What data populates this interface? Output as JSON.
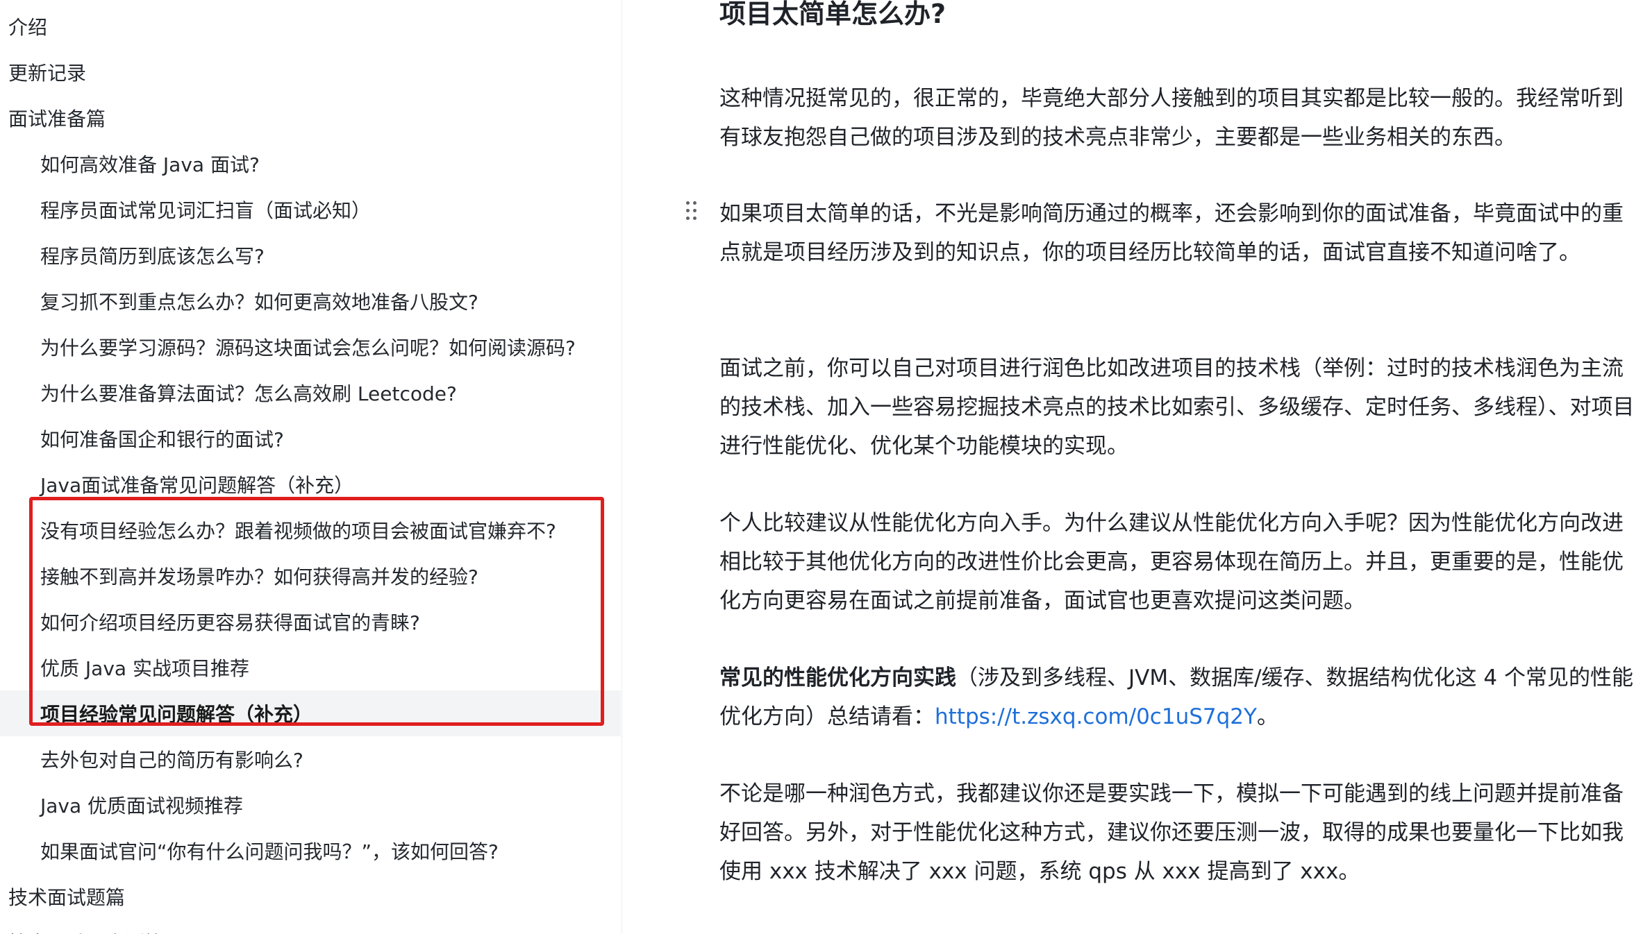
{
  "sidebar": {
    "items": [
      {
        "label": "介绍"
      },
      {
        "label": "更新记录"
      },
      {
        "label": "面试准备篇"
      },
      {
        "label": "如何高效准备 Java 面试?"
      },
      {
        "label": "程序员面试常见词汇扫盲（面试必知）"
      },
      {
        "label": "程序员简历到底该怎么写?"
      },
      {
        "label": "复习抓不到重点怎么办？如何更高效地准备八股文?"
      },
      {
        "label": "为什么要学习源码？源码这块面试会怎么问呢？如何阅读源码?"
      },
      {
        "label": "为什么要准备算法面试？怎么高效刷 Leetcode?"
      },
      {
        "label": "如何准备国企和银行的面试?"
      },
      {
        "label": "Java面试准备常见问题解答（补充）"
      },
      {
        "label": "没有项目经验怎么办？跟着视频做的项目会被面试官嫌弃不?"
      },
      {
        "label": "接触不到高并发场景咋办？如何获得高并发的经验?"
      },
      {
        "label": "如何介绍项目经历更容易获得面试官的青睐?"
      },
      {
        "label": "优质 Java 实战项目推荐"
      },
      {
        "label": "项目经验常见问题解答（补充）"
      },
      {
        "label": "去外包对自己的简历有影响么?"
      },
      {
        "label": "Java 优质面试视频推荐"
      },
      {
        "label": "如果面试官问“你有什么问题问我吗？”，该如何回答?"
      },
      {
        "label": "技术面试题篇"
      },
      {
        "label": "技术面试题自测篇"
      }
    ]
  },
  "content": {
    "heading": "项目太简单怎么办?",
    "p1": "这种情况挺常见的，很正常的，毕竟绝大部分人接触到的项目其实都是比较一般的。我经常听到有球友抱怨自己做的项目涉及到的技术亮点非常少，主要都是一些业务相关的东西。",
    "p2": "如果项目太简单的话，不光是影响简历通过的概率，还会影响到你的面试准备，毕竟面试中的重点就是项目经历涉及到的知识点，你的项目经历比较简单的话，面试官直接不知道问啥了。",
    "p3": "面试之前，你可以自己对项目进行润色比如改进项目的技术栈（举例：过时的技术栈润色为主流的技术栈、加入一些容易挖掘技术亮点的技术比如索引、多级缓存、定时任务、多线程）、对项目进行性能优化、优化某个功能模块的实现。",
    "p4": "个人比较建议从性能优化方向入手。为什么建议从性能优化方向入手呢？因为性能优化方向改进相比较于其他优化方向的改进性价比会更高，更容易体现在简历上。并且，更重要的是，性能优化方向更容易在面试之前提前准备，面试官也更喜欢提问这类问题。",
    "p5_bold": "常见的性能优化方向实践",
    "p5_text": "（涉及到多线程、JVM、数据库/缓存、数据结构优化这 4 个常见的性能优化方向）总结请看：",
    "p5_link": "https://t.zsxq.com/0c1uS7q2Y",
    "p5_end": "。",
    "p6": "不论是哪一种润色方式，我都建议你还是要实践一下，模拟一下可能遇到的线上问题并提前准备好回答。另外，对于性能优化这种方式，建议你还要压测一波，取得的成果也要量化一下比如我使用 xxx 技术解决了 xxx 问题，系统 qps 从 xxx 提高到了 xxx。"
  }
}
